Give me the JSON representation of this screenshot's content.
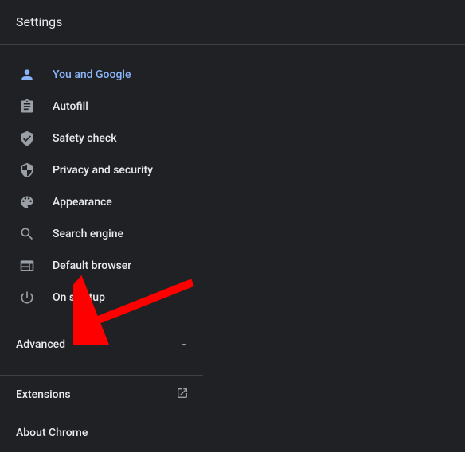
{
  "header": {
    "title": "Settings"
  },
  "menu": {
    "items": [
      {
        "label": "You and Google",
        "icon": "person-icon",
        "active": true
      },
      {
        "label": "Autofill",
        "icon": "clipboard-icon",
        "active": false
      },
      {
        "label": "Safety check",
        "icon": "shield-check-icon",
        "active": false
      },
      {
        "label": "Privacy and security",
        "icon": "shield-icon",
        "active": false
      },
      {
        "label": "Appearance",
        "icon": "palette-icon",
        "active": false
      },
      {
        "label": "Search engine",
        "icon": "search-icon",
        "active": false
      },
      {
        "label": "Default browser",
        "icon": "browser-icon",
        "active": false
      },
      {
        "label": "On startup",
        "icon": "power-icon",
        "active": false
      }
    ]
  },
  "sections": {
    "advanced": {
      "label": "Advanced"
    },
    "extensions": {
      "label": "Extensions"
    },
    "about": {
      "label": "About Chrome"
    }
  },
  "annotation": {
    "arrow_color": "#ff0000"
  }
}
